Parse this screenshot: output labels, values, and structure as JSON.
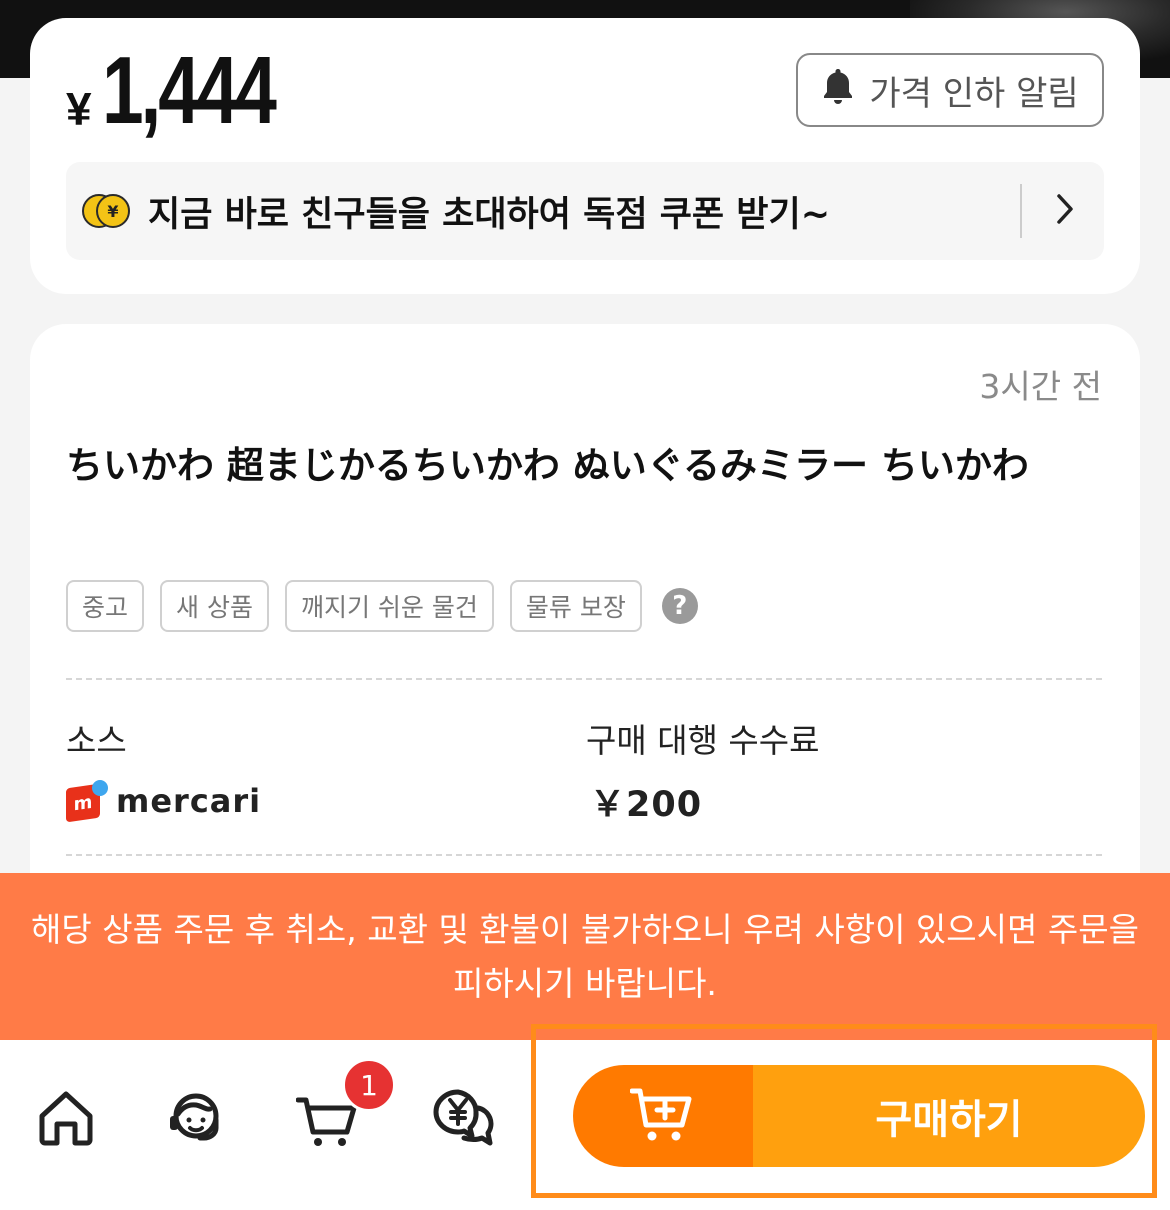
{
  "price": {
    "currency_symbol": "¥",
    "amount": "1,444"
  },
  "price_alert_button": {
    "label": "가격 인하 알림",
    "icon": "bell-icon"
  },
  "invite_banner": {
    "icon": "coin-icon",
    "coin_symbol": "¥",
    "text": "지금 바로 친구들을 초대하여 독점 쿠폰 받기~",
    "chevron": "chevron-right-icon"
  },
  "item": {
    "time_ago": "3시간 전",
    "title": "ちいかわ 超まじかるちいかわ ぬいぐるみミラー ちいかわ",
    "tags": [
      "중고",
      "새 상품",
      "깨지기 쉬운 물건",
      "물류 보장"
    ],
    "help_icon_glyph": "?"
  },
  "details": {
    "source_label": "소스",
    "source_logo_mark": "m",
    "source_name": "mercari",
    "fee_label": "구매 대행 수수료",
    "fee_value": "￥200"
  },
  "warning": {
    "text": "해당 상품 주문 후 취소, 교환 및 환불이 불가하오니 우려 사항이 있으시면 주문을 피하시기 바랍니다."
  },
  "bottom_nav": {
    "items": [
      {
        "name": "home",
        "icon": "home-icon"
      },
      {
        "name": "customer-service",
        "icon": "headset-icon"
      },
      {
        "name": "cart",
        "icon": "cart-icon",
        "badge": "1"
      },
      {
        "name": "currency-chat",
        "icon": "yen-chat-icon"
      }
    ],
    "add_to_cart_icon": "cart-plus-icon",
    "buy_label": "구매하기"
  },
  "colors": {
    "warning_bg": "#ff7b47",
    "add_cart_bg": "#ff7a00",
    "buy_bg": "#ffa00e",
    "badge": "#e63232",
    "highlight": "#ff8c1a"
  }
}
